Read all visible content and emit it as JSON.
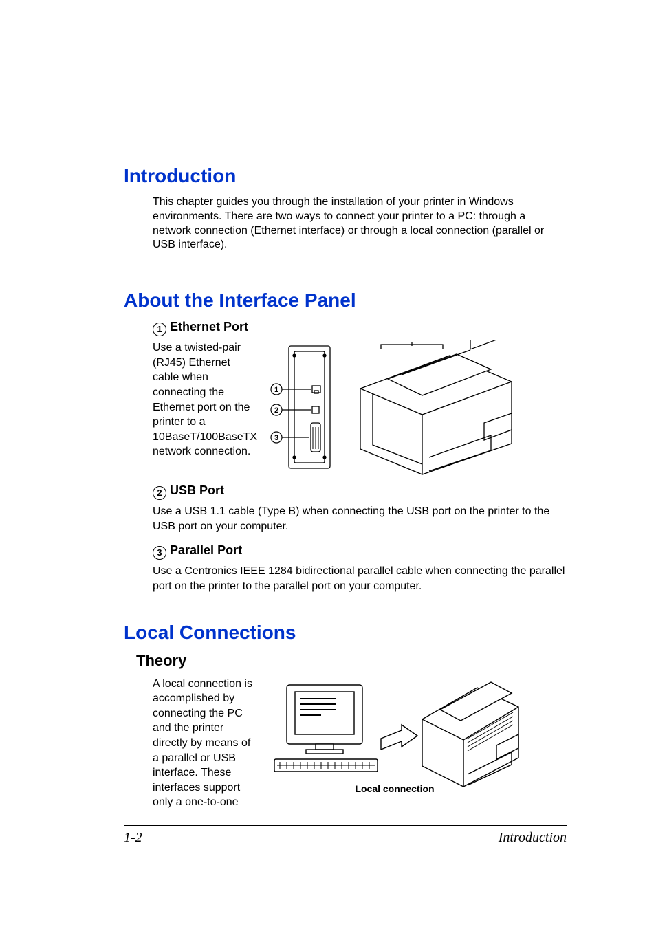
{
  "headings": {
    "introduction": "Introduction",
    "about_interface": "About the Interface Panel",
    "local_connections": "Local Connections",
    "theory": "Theory"
  },
  "intro_paragraph": "This chapter guides you through the installation of your printer in Windows environments. There are two ways to connect your printer to a PC: through a network connection (Ethernet interface) or through a local connection (parallel or USB interface).",
  "ports": {
    "ethernet": {
      "num": "1",
      "title": "Ethernet Port",
      "desc": "Use a twisted-pair (RJ45) Ethernet cable when connecting the Ethernet port on the printer to a 10BaseT/100BaseTX network connection."
    },
    "usb": {
      "num": "2",
      "title": "USB Port",
      "desc": "Use a USB 1.1 cable (Type B) when connecting the USB port on the printer to the USB port on your computer."
    },
    "parallel": {
      "num": "3",
      "title": "Parallel Port",
      "desc": "Use a Centronics IEEE 1284 bidirectional parallel cable when connecting the parallel port on the printer to the parallel port on your computer."
    }
  },
  "theory_text": "A local connection is accomplished by connecting the PC and the printer directly by means of a parallel or USB interface. These interfaces support only a one-to-one",
  "figure_caption": "Local connection",
  "footer": {
    "page_num": "1-2",
    "chapter": "Introduction"
  },
  "diagram_labels": {
    "a": "1",
    "b": "2",
    "c": "3"
  }
}
